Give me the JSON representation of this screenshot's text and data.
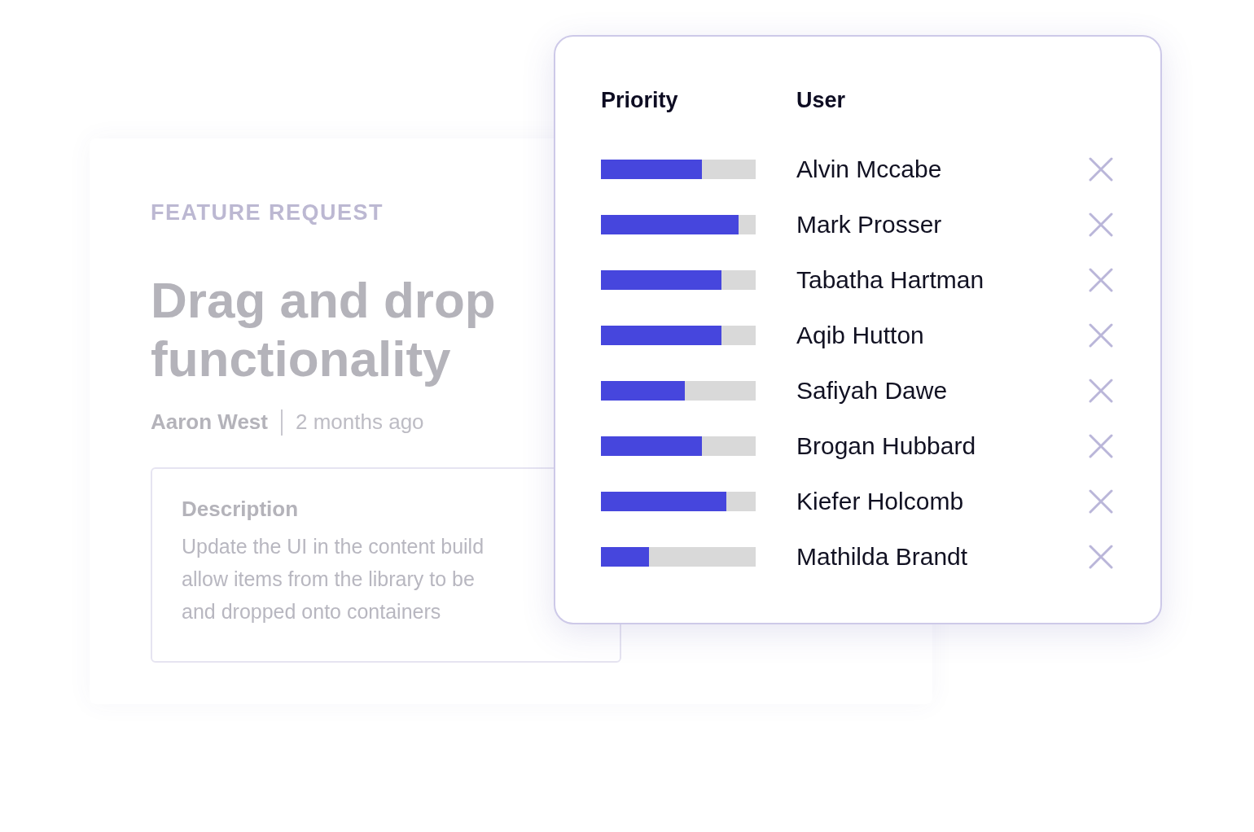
{
  "card": {
    "eyebrow": "FEATURE REQUEST",
    "title": "Drag and drop functionality",
    "author": "Aaron West",
    "time": "2 months ago",
    "description": {
      "heading": "Description",
      "lines": [
        "Update the UI in the content build",
        "allow items from the library to be",
        "and dropped onto containers"
      ]
    }
  },
  "priority_panel": {
    "columns": [
      "Priority",
      "User"
    ],
    "rows": [
      {
        "level": 0.65,
        "user": "Alvin Mccabe"
      },
      {
        "level": 0.89,
        "user": "Mark Prosser"
      },
      {
        "level": 0.78,
        "user": "Tabatha Hartman"
      },
      {
        "level": 0.78,
        "user": "Aqib Hutton"
      },
      {
        "level": 0.54,
        "user": "Safiyah Dawe"
      },
      {
        "level": 0.65,
        "user": "Brogan Hubbard"
      },
      {
        "level": 0.81,
        "user": "Kiefer Holcomb"
      },
      {
        "level": 0.31,
        "user": "Mathilda Brandt"
      }
    ]
  }
}
